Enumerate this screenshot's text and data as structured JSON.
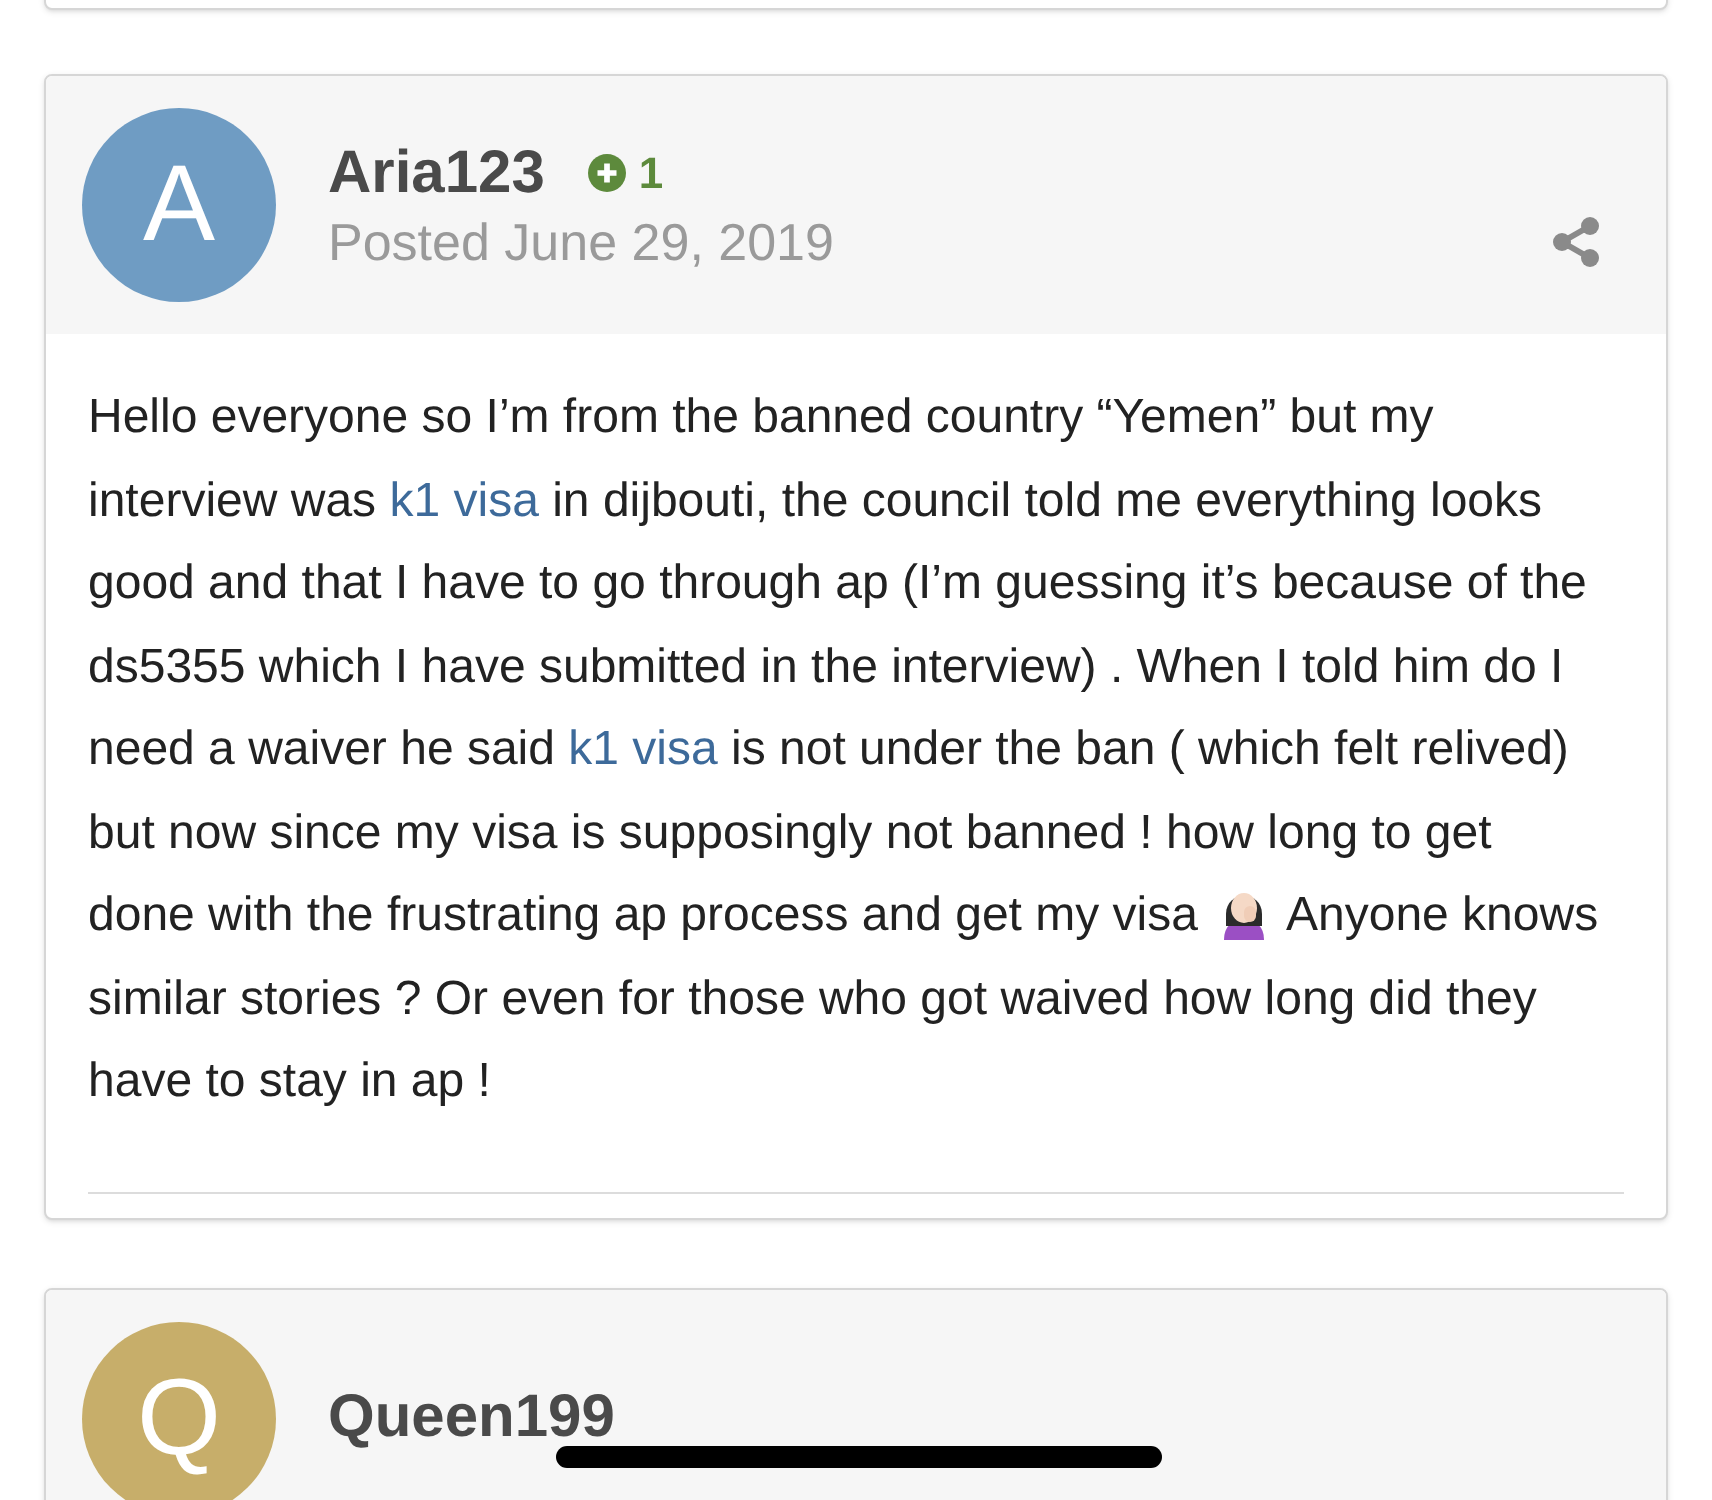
{
  "posts": [
    {
      "author": "Aria123",
      "avatar_letter": "A",
      "color": "#6f9cc3",
      "reputation": "1",
      "posted": "Posted June 29, 2019",
      "body": [
        {
          "kind": "text",
          "text": "Hello everyone so I’m from the banned country “Yemen” but my interview was "
        },
        {
          "kind": "link",
          "text": "k1 visa"
        },
        {
          "kind": "text",
          "text": " in dijbouti, the council told me everything looks good and that I have to go through ap (I’m guessing it’s because of the ds5355 which I have submitted in the interview) . When I told him do I need a waiver he said "
        },
        {
          "kind": "link",
          "text": "k1 visa"
        },
        {
          "kind": "text",
          "text": " is not under the ban ( which felt relived) but now since my visa is supposingly not banned ! how long to get done with the frustrating ap process and get my visa "
        },
        {
          "kind": "emoji"
        },
        {
          "kind": "text",
          "text": " Anyone knows similar stories ? Or even for those who got waived how long did they have to stay in ap !"
        }
      ]
    },
    {
      "author": "Queen199",
      "avatar_letter": "Q",
      "color": "#c7ae6a"
    }
  ]
}
